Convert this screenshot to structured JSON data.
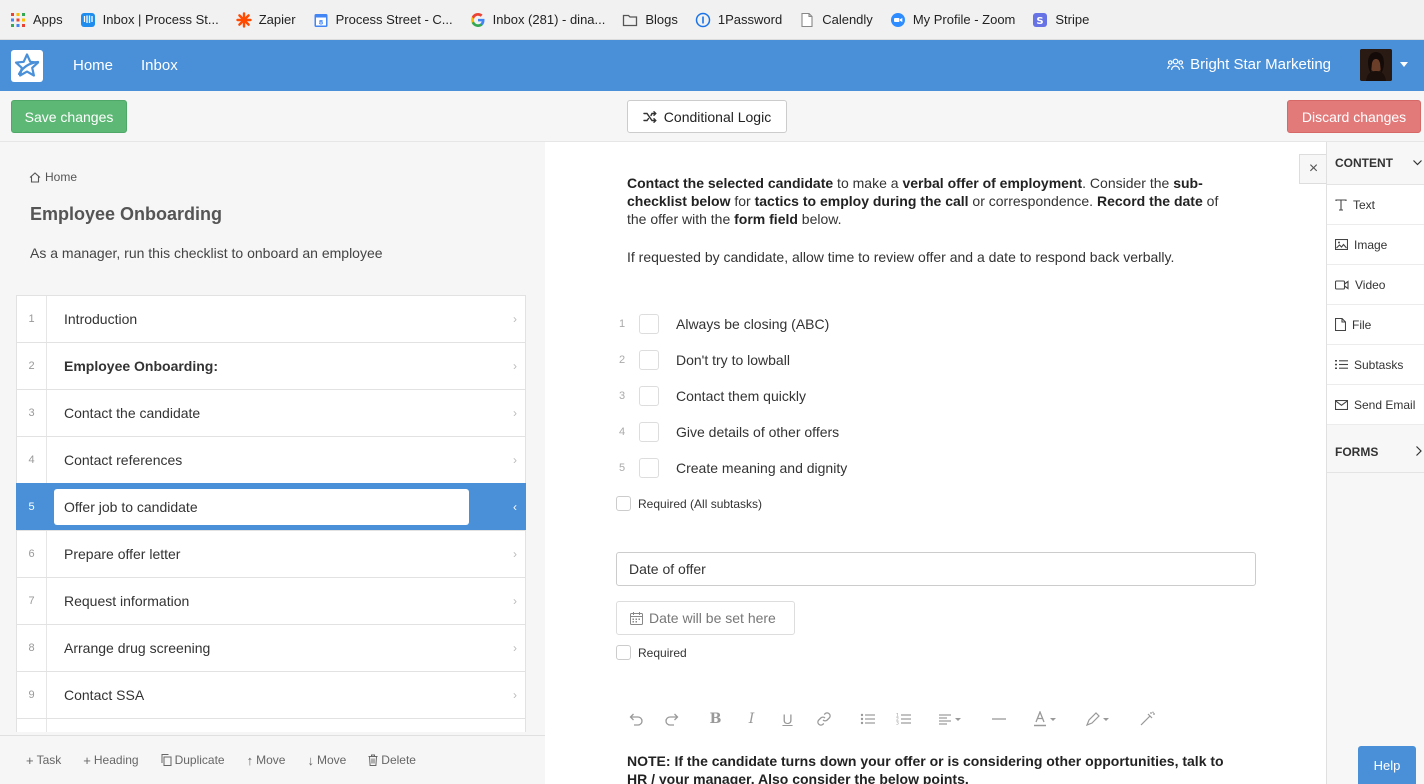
{
  "bookmarks": [
    {
      "label": "Apps",
      "icon": "apps-grid-icon",
      "color": "#e94235"
    },
    {
      "label": "Inbox | Process St...",
      "icon": "intercom-icon",
      "color": "#1f8ded"
    },
    {
      "label": "Zapier",
      "icon": "zapier-icon",
      "color": "#ff4a00"
    },
    {
      "label": "Process Street - C...",
      "icon": "calendar-icon",
      "color": "#4285f4"
    },
    {
      "label": "Inbox (281) - dina...",
      "icon": "google-icon",
      "color": "#4285f4"
    },
    {
      "label": "Blogs",
      "icon": "folder-icon",
      "color": "#555555"
    },
    {
      "label": "1Password",
      "icon": "1password-icon",
      "color": "#1a73e8"
    },
    {
      "label": "Calendly",
      "icon": "calendly-icon",
      "color": "#777777"
    },
    {
      "label": "My Profile - Zoom",
      "icon": "zoom-icon",
      "color": "#2d8cff"
    },
    {
      "label": "Stripe",
      "icon": "stripe-icon",
      "color": "#6772e5"
    }
  ],
  "nav": {
    "home": "Home",
    "inbox": "Inbox",
    "org": "Bright Star Marketing"
  },
  "actions": {
    "save": "Save changes",
    "logic": "Conditional Logic",
    "discard": "Discard changes"
  },
  "checklist": {
    "breadcrumb": "Home",
    "title": "Employee Onboarding",
    "description": "As a manager, run this checklist to onboard an employee",
    "tasks": [
      {
        "num": "1",
        "label": "Introduction"
      },
      {
        "num": "2",
        "label": "Employee Onboarding:"
      },
      {
        "num": "3",
        "label": "Contact the candidate"
      },
      {
        "num": "4",
        "label": "Contact references"
      },
      {
        "num": "5",
        "label": "Offer job to candidate"
      },
      {
        "num": "6",
        "label": "Prepare offer letter"
      },
      {
        "num": "7",
        "label": "Request information"
      },
      {
        "num": "8",
        "label": "Arrange drug screening"
      },
      {
        "num": "9",
        "label": "Contact SSA"
      }
    ]
  },
  "bottom_actions": {
    "task": "Task",
    "heading": "Heading",
    "duplicate": "Duplicate",
    "move_up": "Move",
    "move_down": "Move",
    "delete": "Delete"
  },
  "editor": {
    "p1": {
      "s1": "Contact the selected candidate",
      "s2": " to make a ",
      "s3": "verbal offer of employment",
      "s4": ". Consider the ",
      "s5": "sub-",
      "s6": "checklist below",
      "s7": " for ",
      "s8": "tactics to employ during the call",
      "s9": " or correspondence. ",
      "s10": "Record the date",
      "s11": " of",
      "s12": "the offer with the ",
      "s13": "form field",
      "s14": " below."
    },
    "p2": "If requested by candidate, allow time to review offer and a date to respond back verbally.",
    "subtasks": [
      {
        "num": "1",
        "label": "Always be closing (ABC)"
      },
      {
        "num": "2",
        "label": "Don't try to lowball"
      },
      {
        "num": "3",
        "label": "Contact them quickly"
      },
      {
        "num": "4",
        "label": "Give details of other offers"
      },
      {
        "num": "5",
        "label": "Create meaning and dignity"
      }
    ],
    "subtasks_required": "Required (All subtasks)",
    "date_field_label": "Date of offer",
    "date_placeholder": "Date will be set here",
    "date_required": "Required",
    "note_line1": "NOTE: If the candidate turns down your offer or is considering other opportunities, talk to",
    "note_line2": "HR / your manager. Also consider the below points."
  },
  "widgets": {
    "content_header": "CONTENT",
    "items": [
      {
        "label": "Text",
        "icon": "text-icon"
      },
      {
        "label": "Image",
        "icon": "image-icon"
      },
      {
        "label": "Video",
        "icon": "video-icon"
      },
      {
        "label": "File",
        "icon": "file-icon"
      },
      {
        "label": "Subtasks",
        "icon": "list-icon"
      },
      {
        "label": "Send Email",
        "icon": "email-icon"
      }
    ],
    "forms_header": "FORMS"
  },
  "help": "Help",
  "colors": {
    "primary": "#4a90d9",
    "save": "#5cb874",
    "discard": "#e27a7a"
  }
}
